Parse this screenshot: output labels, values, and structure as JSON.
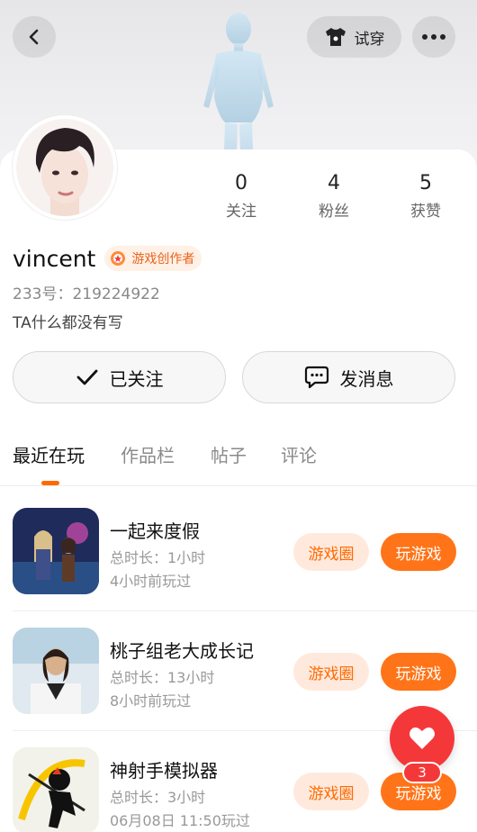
{
  "header": {
    "back_icon": "chevron-left-icon",
    "tryon_label": "试穿",
    "tryon_icon": "tshirt-icon",
    "more_icon": "more-dots-icon"
  },
  "profile": {
    "username": "vincent",
    "badge_label": "游戏创作者",
    "uid": "233号：219224922",
    "bio": "TA什么都没有写",
    "stats": [
      {
        "value": "0",
        "label": "关注"
      },
      {
        "value": "4",
        "label": "粉丝"
      },
      {
        "value": "5",
        "label": "获赞"
      }
    ]
  },
  "actions": {
    "follow_label": "已关注",
    "message_label": "发消息"
  },
  "tabs": [
    {
      "label": "最近在玩",
      "active": true
    },
    {
      "label": "作品栏",
      "active": false
    },
    {
      "label": "帖子",
      "active": false
    },
    {
      "label": "评论",
      "active": false
    }
  ],
  "games": [
    {
      "title": "一起来度假",
      "duration": "总时长：1小时",
      "last_played": "4小时前玩过",
      "circle_label": "游戏圈",
      "play_label": "玩游戏"
    },
    {
      "title": "桃子组老大成长记",
      "duration": "总时长：13小时",
      "last_played": "8小时前玩过",
      "circle_label": "游戏圈",
      "play_label": "玩游戏"
    },
    {
      "title": "神射手模拟器",
      "duration": "总时长：3小时",
      "last_played": "06月08日 11:50玩过",
      "circle_label": "游戏圈",
      "play_label": "玩游戏"
    }
  ],
  "like_fab": {
    "count": "3",
    "icon": "heart-icon"
  },
  "colors": {
    "accent": "#ff7418",
    "accent_light": "#ffe9dd",
    "like_red": "#f4383a"
  }
}
